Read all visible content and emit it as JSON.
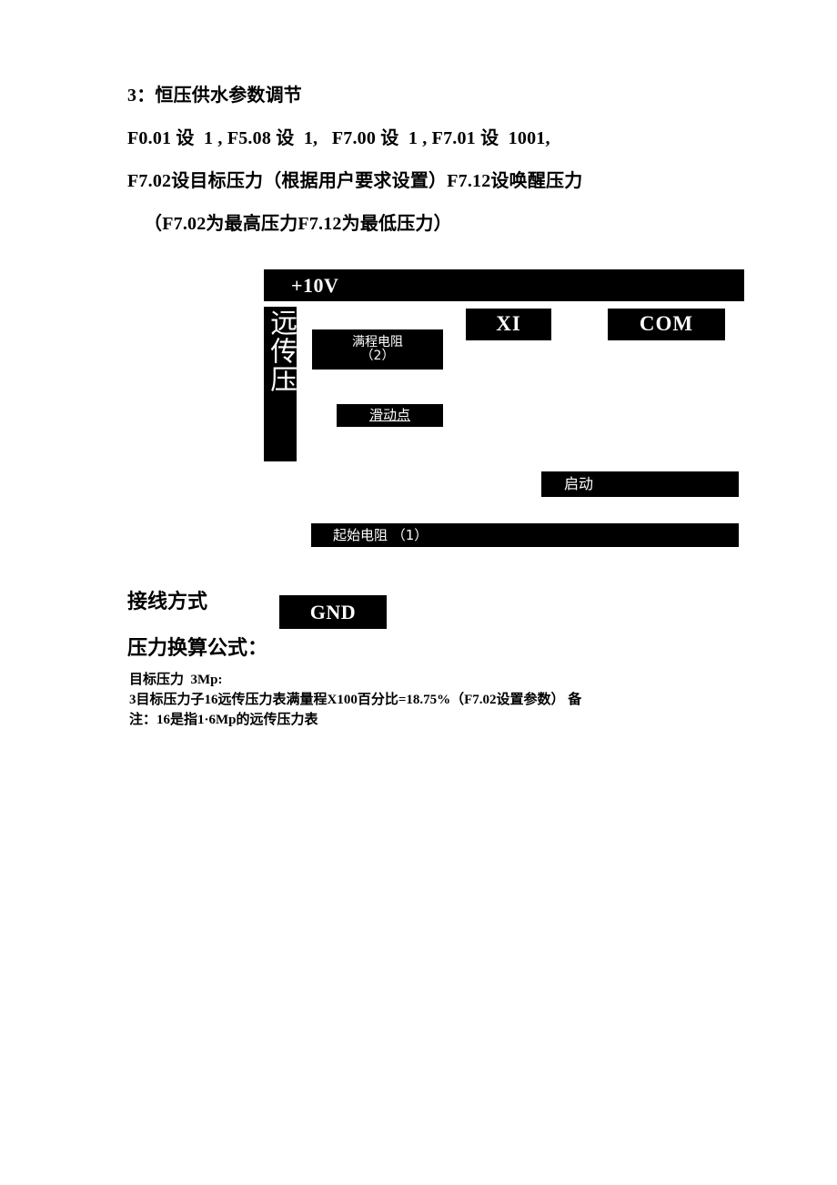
{
  "document": {
    "page_background": "#ffffff",
    "ink_color": "#000000"
  },
  "heading": {
    "line1": "3：恒压供水参数调节",
    "line2": "F0.01 设  1 , F5.08 设  1,   F7.00 设  1 , F7.01 设  1001,",
    "line3": "F7.02设目标压力（根据用户要求设置）F7.12设唤醒压力",
    "line4": "（F7.02为最高压力F7.12为最低压力）"
  },
  "diagram": {
    "supply_rail_label": "+10V",
    "remote_sensor_label": "远传压",
    "full_range_resistor_label": "满程电阻\n（2）",
    "xi_terminal_label": "XI",
    "com_terminal_label": "COM",
    "slider_point_label": "滑动点",
    "start_label": "启动",
    "initial_resistor_label": "起始电阻 （1）",
    "gnd_terminal_label": "GND"
  },
  "labels": {
    "wiring_method": "接线方式",
    "pressure_formula_title": "压力换算公式："
  },
  "calculation": {
    "line1": "目标压力  3Mp:",
    "line2": "3目标压力子16远传压力表满量程X100百分比=18.75%（F7.02设置参数） 备",
    "line3": "注：16是指1·6Mp的远传压力表"
  }
}
